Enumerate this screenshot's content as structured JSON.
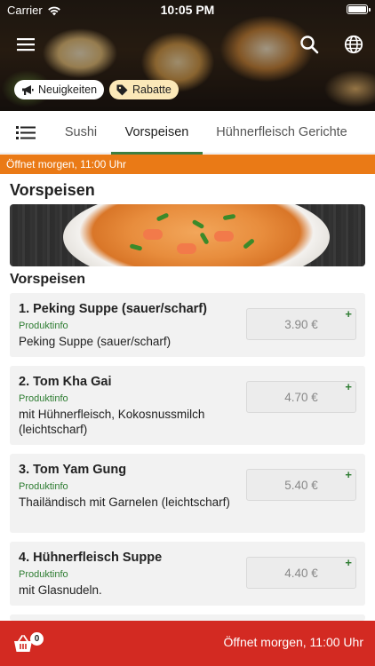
{
  "status_bar": {
    "carrier": "Carrier",
    "time": "10:05 PM"
  },
  "header": {
    "chips": [
      {
        "label": "Neuigkeiten",
        "icon": "megaphone-icon"
      },
      {
        "label": "Rabatte",
        "icon": "tag-icon"
      }
    ]
  },
  "tabs": [
    {
      "label": "Sushi"
    },
    {
      "label": "Vorspeisen",
      "active": true
    },
    {
      "label": "Hühnerfleisch Gerichte"
    }
  ],
  "banner": {
    "text": "Öffnet morgen, 11:00 Uhr"
  },
  "section": {
    "title": "Vorspeisen",
    "subtitle": "Vorspeisen"
  },
  "products": [
    {
      "name": "1. Peking Suppe (sauer/scharf)",
      "info": "Produktinfo",
      "desc": "Peking Suppe (sauer/scharf)",
      "price": "3.90 €"
    },
    {
      "name": "2. Tom Kha Gai",
      "info": "Produktinfo",
      "desc": "mit Hühnerfleisch, Kokosnussmilch (leichtscharf)",
      "price": "4.70 €"
    },
    {
      "name": "3. Tom Yam Gung",
      "info": "Produktinfo",
      "desc": "Thailändisch mit Garnelen (leichtscharf)",
      "price": "5.40 €"
    },
    {
      "name": "4. Hühnerfleisch Suppe",
      "info": "Produktinfo",
      "desc": "mit Glasnudeln.",
      "price": "4.40 €"
    }
  ],
  "bottom_bar": {
    "cart_count": "0",
    "text": "Öffnet morgen, 11:00 Uhr"
  },
  "colors": {
    "accent_green": "#3c7f42",
    "banner_orange": "#ea7a16",
    "bottom_red": "#d32a22",
    "chip_yellow": "#fbe8b8"
  }
}
